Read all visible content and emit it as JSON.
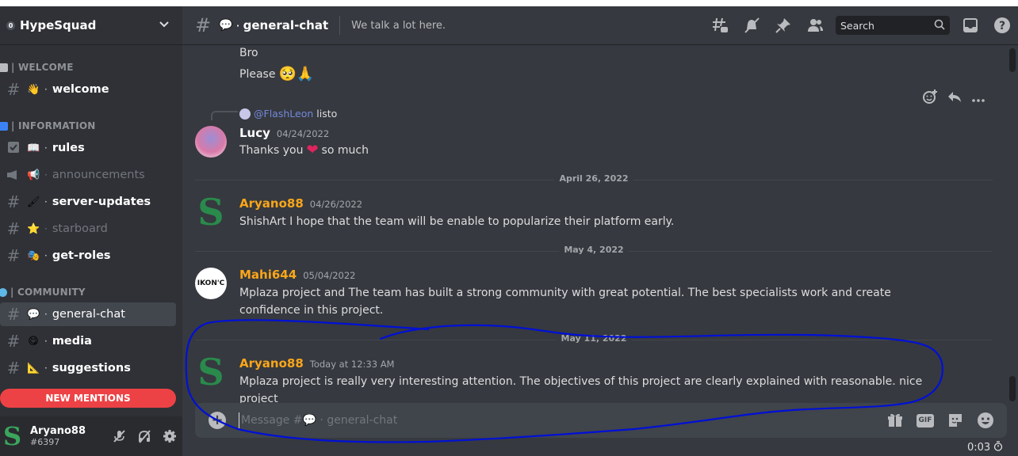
{
  "server": {
    "name": "HypeSquad",
    "badge": "0"
  },
  "sidebar": {
    "categories": [
      {
        "label": "| WELCOME",
        "color": "#b9bbbe"
      },
      {
        "label": "| INFORMATION",
        "color": "#3b82f6"
      },
      {
        "label": "| COMMUNITY",
        "color": "#5fb8e6"
      }
    ],
    "channels": [
      {
        "emoji": "👋",
        "name": "welcome"
      },
      {
        "emoji": "📖",
        "name": "rules"
      },
      {
        "emoji": "📢",
        "name": "announcements"
      },
      {
        "emoji": "🖌",
        "name": "server-updates"
      },
      {
        "emoji": "⭐",
        "name": "starboard"
      },
      {
        "emoji": "🎭",
        "name": "get-roles"
      },
      {
        "emoji": "💬",
        "name": "general-chat"
      },
      {
        "emoji": "😋",
        "name": "media"
      },
      {
        "emoji": "📐",
        "name": "suggestions"
      }
    ],
    "new_mentions": "NEW MENTIONS"
  },
  "user": {
    "name": "Aryano88",
    "tag": "#6397"
  },
  "header": {
    "channel_emoji": "💬",
    "channel_name": "general-chat",
    "topic": "We talk a lot here.",
    "search_placeholder": "Search"
  },
  "messages": {
    "top_lines": [
      "Bro",
      "Please"
    ],
    "reply": {
      "mention": "@FlashLeon",
      "text": "listo"
    },
    "lucy": {
      "author": "Lucy",
      "timestamp": "04/24/2022",
      "text_before": "Thanks you",
      "text_after": "so much"
    },
    "divider1": "April 26, 2022",
    "aryano1": {
      "author": "Aryano88",
      "timestamp": "04/26/2022",
      "text": "ShishArt I hope that the team will be enable to popularize their platform early."
    },
    "divider2": "May 4, 2022",
    "mahi": {
      "author": "Mahi644",
      "timestamp": "05/04/2022",
      "avatar_text": "IKON'C",
      "text": "Mplaza project and The team has built a strong community with great potential. The best specialists work and create confidence in this project."
    },
    "divider3": "May 11, 2022",
    "aryano2": {
      "author": "Aryano88",
      "timestamp": "Today at 12:33 AM",
      "text": "Mplaza project is really very interesting attention. The objectives of this project are clearly explained with reasonable. nice project"
    }
  },
  "composer": {
    "placeholder": "Message #💬 · general-chat",
    "gif_label": "GIF"
  },
  "timer": "0:03",
  "colors": {
    "accent_username": "#faa61a",
    "lucy_name": "#ffffff",
    "mention": "#7289da",
    "annotation": "#0010d6",
    "mentions_red": "#ed4245"
  }
}
